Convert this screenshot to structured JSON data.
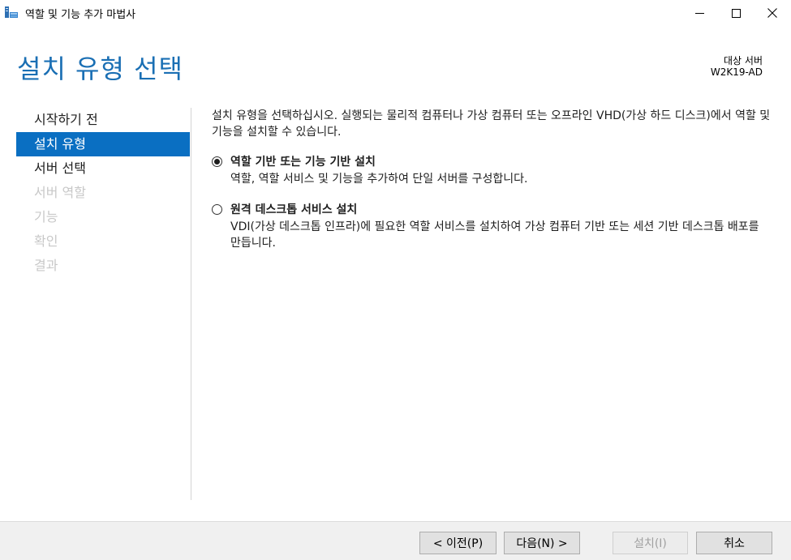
{
  "window": {
    "title": "역할 및 기능 추가 마법사"
  },
  "header": {
    "page_title": "설치 유형 선택",
    "target_label": "대상 서버",
    "target_name": "W2K19-AD"
  },
  "nav": {
    "items": [
      {
        "label": "시작하기 전",
        "state": "normal"
      },
      {
        "label": "설치 유형",
        "state": "active"
      },
      {
        "label": "서버 선택",
        "state": "normal"
      },
      {
        "label": "서버 역할",
        "state": "disabled"
      },
      {
        "label": "기능",
        "state": "disabled"
      },
      {
        "label": "확인",
        "state": "disabled"
      },
      {
        "label": "결과",
        "state": "disabled"
      }
    ]
  },
  "main": {
    "description": "설치 유형을 선택하십시오. 실행되는 물리적 컴퓨터나 가상 컴퓨터 또는 오프라인 VHD(가상 하드 디스크)에서 역할 및 기능을 설치할 수 있습니다.",
    "options": [
      {
        "label": "역할 기반 또는 기능 기반 설치",
        "description": "역할, 역할 서비스 및 기능을 추가하여 단일 서버를 구성합니다.",
        "selected": true
      },
      {
        "label": "원격 데스크톱 서비스 설치",
        "description": "VDI(가상 데스크톱 인프라)에 필요한 역할 서비스를 설치하여 가상 컴퓨터 기반 또는 세션 기반 데스크톱 배포를 만듭니다.",
        "selected": false
      }
    ]
  },
  "footer": {
    "prev_label": "< 이전(P)",
    "next_label": "다음(N) >",
    "install_label": "설치(I)",
    "cancel_label": "취소"
  },
  "colors": {
    "accent": "#0a6fc2",
    "title_blue": "#1a6fb4"
  }
}
